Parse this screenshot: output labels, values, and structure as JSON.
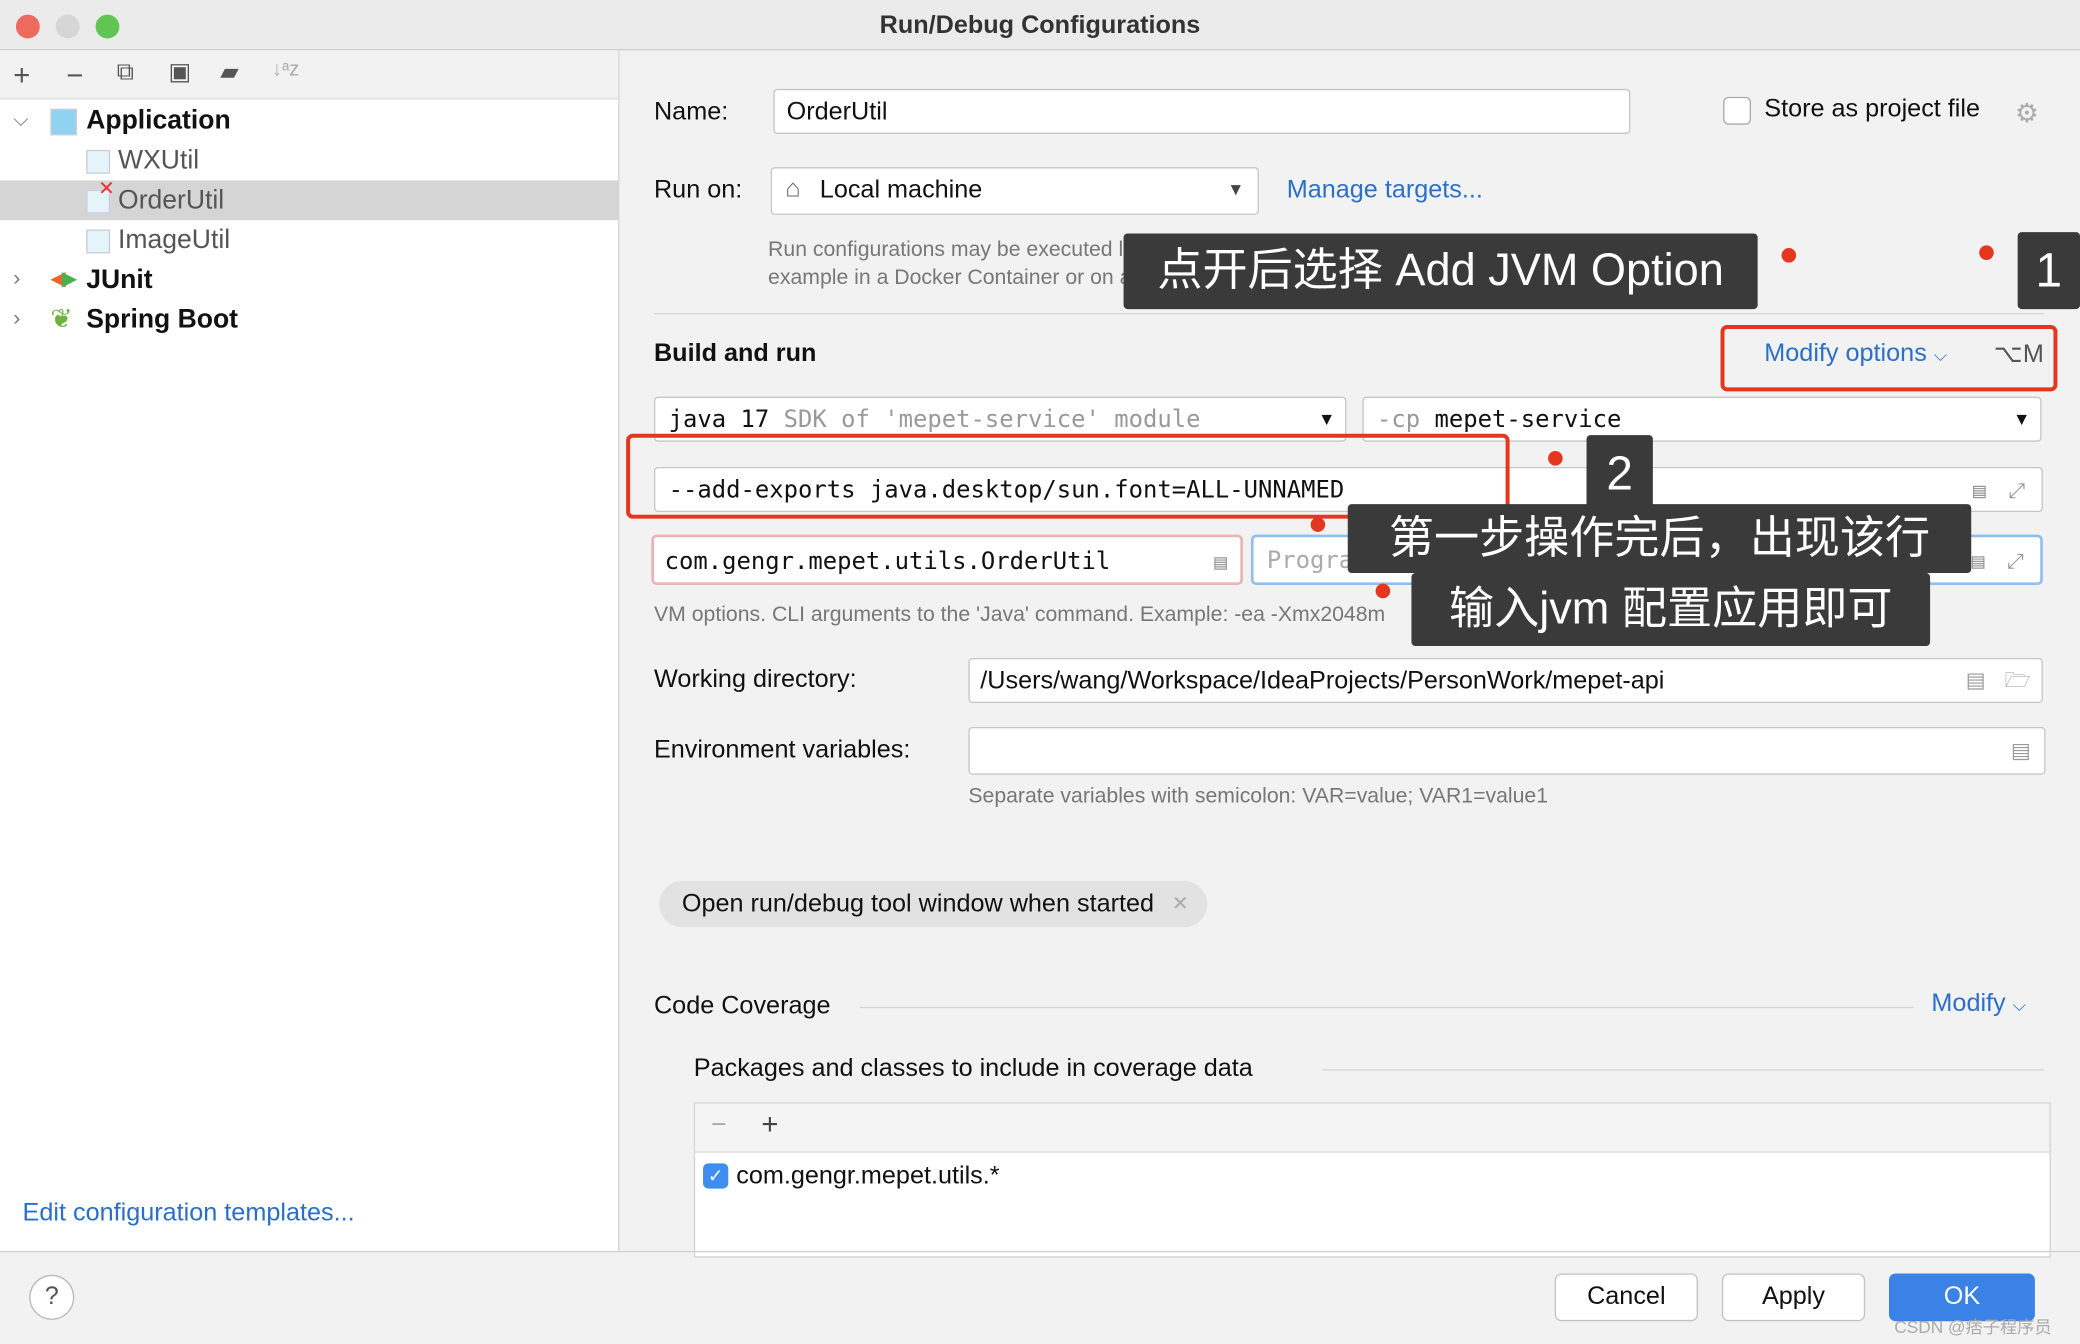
{
  "window": {
    "title": "Run/Debug Configurations",
    "traffic_colors": [
      "#ed6a5e",
      "#d6d6d6",
      "#61c554"
    ]
  },
  "left_toolbar": {
    "icons": [
      "plus-icon",
      "minus-icon",
      "copy-icon",
      "save-icon",
      "folder-add-icon",
      "sort-icon"
    ],
    "add": "+",
    "remove": "−",
    "sort": "↓ᵃz"
  },
  "tree": [
    {
      "label": "Application",
      "bold": true,
      "expanded": true
    },
    {
      "label": "WXUtil"
    },
    {
      "label": "OrderUtil",
      "selected": true,
      "error": true
    },
    {
      "label": "ImageUtil"
    },
    {
      "label": "JUnit",
      "bold": true
    },
    {
      "label": "Spring Boot",
      "bold": true
    }
  ],
  "edit_templates": "Edit configuration templates...",
  "form": {
    "name_label": "Name:",
    "name_value": "OrderUtil",
    "store_label": "Store as project file",
    "store_checked": false,
    "run_on_label": "Run on:",
    "run_on_value": "Local machine",
    "manage_targets": "Manage targets...",
    "run_hint_1": "Run configurations may be executed locally or on a target: for",
    "run_hint_2": "example in a Docker Container or on a remote host using SSH.",
    "build_run": "Build and run",
    "modify_options": "Modify options",
    "modify_shortcut": "⌥M",
    "jdk_main": "java 17",
    "jdk_sub": "SDK of 'mepet-service' module",
    "cp_prefix": "-cp",
    "cp_value": "mepet-service",
    "vm_options": "--add-exports java.desktop/sun.font=ALL-UNNAMED",
    "main_class": "com.gengr.mepet.utils.OrderUtil",
    "program_args_placeholder": "Program arguments",
    "vm_hint": "VM options. CLI arguments to the 'Java' command. Example: -ea -Xmx2048m",
    "workdir_label": "Working directory:",
    "workdir_value": "/Users/wang/Workspace/IdeaProjects/PersonWork/mepet-api",
    "env_label": "Environment variables:",
    "env_value": "",
    "env_hint": "Separate variables with semicolon: VAR=value; VAR1=value1",
    "chip": "Open run/debug tool window when started",
    "coverage_title": "Code Coverage",
    "coverage_modify": "Modify",
    "packages_title": "Packages and classes to include in coverage data",
    "package_item": "com.gengr.mepet.utils.*",
    "package_checked": true
  },
  "annotations": {
    "step1_text": "点开后选择 Add JVM Option",
    "step1_num": "1",
    "step2_num": "2",
    "step2_text_1": "第一步操作完后，出现该行",
    "step2_text_2": "输入jvm 配置应用即可",
    "accent": "#e5371f"
  },
  "buttons": {
    "help": "?",
    "cancel": "Cancel",
    "apply": "Apply",
    "ok": "OK"
  },
  "watermark": "CSDN @痞子程序员"
}
